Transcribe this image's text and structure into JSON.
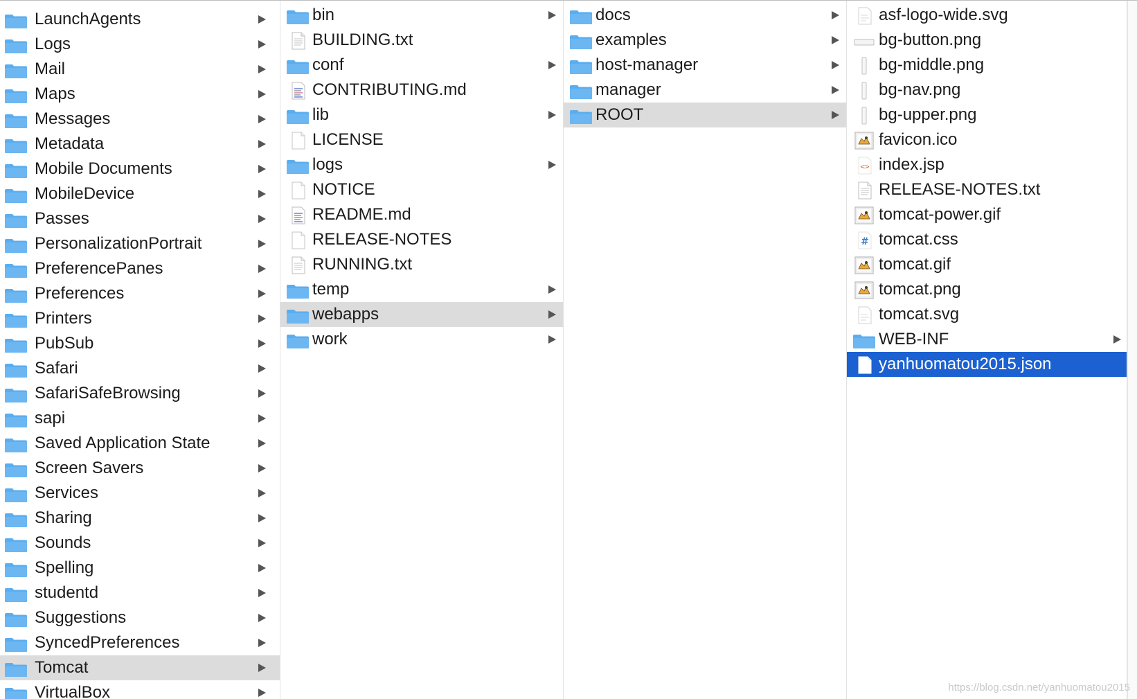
{
  "colors": {
    "selection_blue": "#1b61d1",
    "selection_gray": "#dcdcdc",
    "folder": "#6cb6f2"
  },
  "columns": [
    {
      "items": [
        {
          "name": "LaunchAgents",
          "type": "folder"
        },
        {
          "name": "Logs",
          "type": "folder"
        },
        {
          "name": "Mail",
          "type": "folder"
        },
        {
          "name": "Maps",
          "type": "folder"
        },
        {
          "name": "Messages",
          "type": "folder"
        },
        {
          "name": "Metadata",
          "type": "folder"
        },
        {
          "name": "Mobile Documents",
          "type": "folder"
        },
        {
          "name": "MobileDevice",
          "type": "folder"
        },
        {
          "name": "Passes",
          "type": "folder"
        },
        {
          "name": "PersonalizationPortrait",
          "type": "folder"
        },
        {
          "name": "PreferencePanes",
          "type": "folder"
        },
        {
          "name": "Preferences",
          "type": "folder"
        },
        {
          "name": "Printers",
          "type": "folder"
        },
        {
          "name": "PubSub",
          "type": "folder"
        },
        {
          "name": "Safari",
          "type": "folder"
        },
        {
          "name": "SafariSafeBrowsing",
          "type": "folder"
        },
        {
          "name": "sapi",
          "type": "folder"
        },
        {
          "name": "Saved Application State",
          "type": "folder"
        },
        {
          "name": "Screen Savers",
          "type": "folder"
        },
        {
          "name": "Services",
          "type": "folder"
        },
        {
          "name": "Sharing",
          "type": "folder"
        },
        {
          "name": "Sounds",
          "type": "folder"
        },
        {
          "name": "Spelling",
          "type": "folder"
        },
        {
          "name": "studentd",
          "type": "folder"
        },
        {
          "name": "Suggestions",
          "type": "folder"
        },
        {
          "name": "SyncedPreferences",
          "type": "folder"
        },
        {
          "name": "Tomcat",
          "type": "folder",
          "selected": "gray"
        },
        {
          "name": "VirtualBox",
          "type": "folder"
        }
      ]
    },
    {
      "items": [
        {
          "name": "bin",
          "type": "folder"
        },
        {
          "name": "BUILDING.txt",
          "type": "text"
        },
        {
          "name": "conf",
          "type": "folder"
        },
        {
          "name": "CONTRIBUTING.md",
          "type": "markdown"
        },
        {
          "name": "lib",
          "type": "folder"
        },
        {
          "name": "LICENSE",
          "type": "blank"
        },
        {
          "name": "logs",
          "type": "folder"
        },
        {
          "name": "NOTICE",
          "type": "blank"
        },
        {
          "name": "README.md",
          "type": "markdown"
        },
        {
          "name": "RELEASE-NOTES",
          "type": "blank"
        },
        {
          "name": "RUNNING.txt",
          "type": "text"
        },
        {
          "name": "temp",
          "type": "folder"
        },
        {
          "name": "webapps",
          "type": "folder",
          "selected": "gray"
        },
        {
          "name": "work",
          "type": "folder"
        }
      ]
    },
    {
      "items": [
        {
          "name": "docs",
          "type": "folder"
        },
        {
          "name": "examples",
          "type": "folder"
        },
        {
          "name": "host-manager",
          "type": "folder"
        },
        {
          "name": "manager",
          "type": "folder"
        },
        {
          "name": "ROOT",
          "type": "folder",
          "selected": "gray"
        }
      ]
    },
    {
      "items": [
        {
          "name": "asf-logo-wide.svg",
          "type": "svg"
        },
        {
          "name": "bg-button.png",
          "type": "png-wide"
        },
        {
          "name": "bg-middle.png",
          "type": "png-tall"
        },
        {
          "name": "bg-nav.png",
          "type": "png-tall"
        },
        {
          "name": "bg-upper.png",
          "type": "png-tall"
        },
        {
          "name": "favicon.ico",
          "type": "image-cat"
        },
        {
          "name": "index.jsp",
          "type": "code"
        },
        {
          "name": "RELEASE-NOTES.txt",
          "type": "text"
        },
        {
          "name": "tomcat-power.gif",
          "type": "image-cat"
        },
        {
          "name": "tomcat.css",
          "type": "css"
        },
        {
          "name": "tomcat.gif",
          "type": "image-cat"
        },
        {
          "name": "tomcat.png",
          "type": "image-cat"
        },
        {
          "name": "tomcat.svg",
          "type": "svg"
        },
        {
          "name": "WEB-INF",
          "type": "folder"
        },
        {
          "name": "yanhuomatou2015.json",
          "type": "blank",
          "selected": "blue"
        }
      ]
    }
  ],
  "watermark": "https://blog.csdn.net/yanhuomatou2015"
}
